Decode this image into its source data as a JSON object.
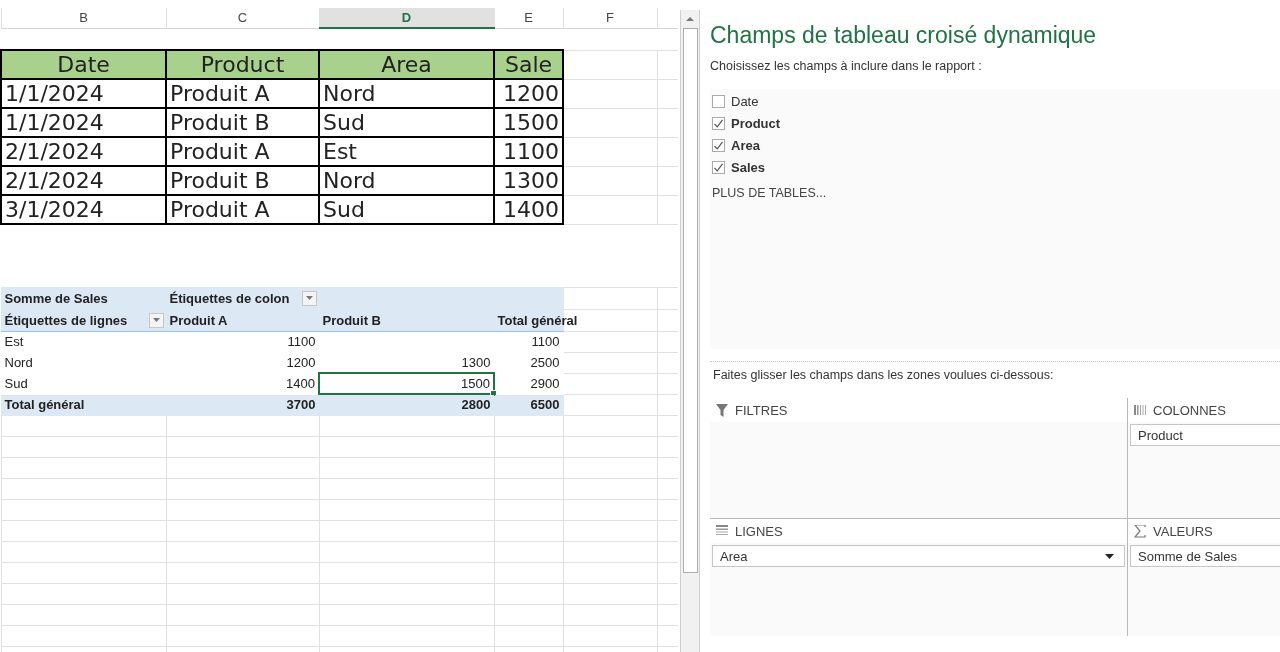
{
  "sheet": {
    "columns": [
      {
        "label": "B",
        "selected": false
      },
      {
        "label": "C",
        "selected": false
      },
      {
        "label": "D",
        "selected": true
      },
      {
        "label": "E",
        "selected": false
      },
      {
        "label": "F",
        "selected": false
      }
    ],
    "data_table": {
      "headers": [
        "Date",
        "Product",
        "Area",
        "Sale"
      ],
      "rows": [
        [
          "1/1/2024",
          "Produit A",
          "Nord",
          "1200"
        ],
        [
          "1/1/2024",
          "Produit B",
          "Sud",
          "1500"
        ],
        [
          "2/1/2024",
          "Produit A",
          "Est",
          "1100"
        ],
        [
          "2/1/2024",
          "Produit B",
          "Nord",
          "1300"
        ],
        [
          "3/1/2024",
          "Produit A",
          "Sud",
          "1400"
        ]
      ]
    },
    "pivot": {
      "value_label": "Somme de Sales",
      "column_labels": "Étiquettes de colon",
      "row_labels": "Étiquettes de lignes",
      "column_headers": [
        "Produit A",
        "Produit B",
        "Total général"
      ],
      "rows": [
        {
          "label": "Est",
          "cells": [
            {
              "text": "1100",
              "selected": false
            },
            {
              "selected": false
            }
          ],
          "total": "1100"
        },
        {
          "label": "Nord",
          "cells": [
            {
              "text": "1200",
              "selected": false
            },
            {
              "text": "1300",
              "selected": false
            }
          ],
          "total": "2500"
        },
        {
          "label": "Sud",
          "cells": [
            {
              "text": "1400",
              "selected": false
            },
            {
              "text": "1500",
              "selected": true
            }
          ],
          "total": "2900"
        }
      ],
      "grand_total": {
        "label": "Total général",
        "cells": [
          "3700",
          "2800"
        ],
        "total": "6500"
      }
    }
  },
  "field_panel": {
    "title": "Champs de tableau croisé dynamique",
    "subtitle": "Choisissez les champs à inclure dans le rapport :",
    "fields": [
      {
        "label": "Date",
        "checked": false
      },
      {
        "label": "Product",
        "checked": true
      },
      {
        "label": "Area",
        "checked": true
      },
      {
        "label": "Sales",
        "checked": true
      }
    ],
    "more_tables": "PLUS DE TABLES...",
    "instruction": "Faites glisser les champs dans les zones voulues ci-dessous:",
    "areas": [
      {
        "kind": "filter",
        "label": "FILTRES"
      },
      {
        "kind": "columns",
        "label": "COLONNES",
        "items": [
          "Product"
        ]
      },
      {
        "kind": "rows",
        "label": "LIGNES",
        "items": [
          "Area"
        ]
      },
      {
        "kind": "values",
        "label": "VALEURS",
        "items": [
          "Somme de Sales"
        ]
      }
    ]
  }
}
